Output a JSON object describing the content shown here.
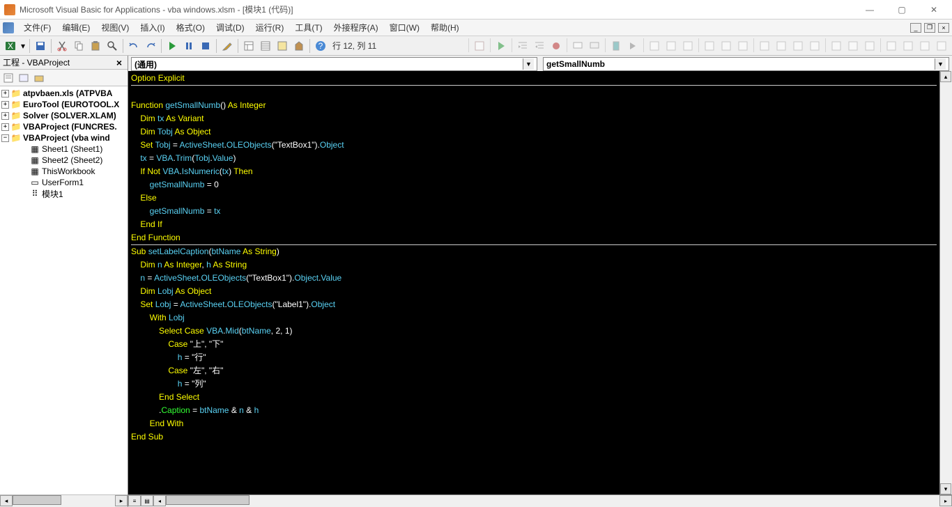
{
  "title": "Microsoft Visual Basic for Applications - vba windows.xlsm - [模块1 (代码)]",
  "menus": {
    "file": "文件(F)",
    "edit": "编辑(E)",
    "view": "视图(V)",
    "insert": "插入(I)",
    "format": "格式(O)",
    "debug": "调试(D)",
    "run": "运行(R)",
    "tools": "工具(T)",
    "addins": "外接程序(A)",
    "window": "窗口(W)",
    "help": "帮助(H)"
  },
  "cursor_position": "行 12, 列 11",
  "project_panel_title": "工程 - VBAProject",
  "tree": {
    "n0": "atpvbaen.xls (ATPVBA",
    "n1": "EuroTool (EUROTOOL.X",
    "n2": "Solver (SOLVER.XLAM)",
    "n3": "VBAProject (FUNCRES.",
    "n4": "VBAProject (vba wind",
    "c0": "Sheet1 (Sheet1)",
    "c1": "Sheet2 (Sheet2)",
    "c2": "ThisWorkbook",
    "c3": "UserForm1",
    "c4": "模块1"
  },
  "combo_left": "(通用)",
  "combo_right": "getSmallNumb",
  "chart_data": {
    "type": "table",
    "note": "VBA source code lines with syntax-highlight token classes",
    "lines": [
      [
        [
          "kw",
          "Option Explicit"
        ]
      ],
      [],
      [
        [
          "kw",
          "Function"
        ],
        [
          "sp",
          " "
        ],
        [
          "id",
          "getSmallNumb"
        ],
        [
          "op",
          "()"
        ],
        [
          "sp",
          " "
        ],
        [
          "kw",
          "As Integer"
        ]
      ],
      [
        [
          "sp",
          "    "
        ],
        [
          "kw",
          "Dim"
        ],
        [
          "sp",
          " "
        ],
        [
          "id",
          "tx"
        ],
        [
          "sp",
          " "
        ],
        [
          "kw",
          "As Variant"
        ]
      ],
      [
        [
          "sp",
          "    "
        ],
        [
          "kw",
          "Dim"
        ],
        [
          "sp",
          " "
        ],
        [
          "id",
          "Tobj"
        ],
        [
          "sp",
          " "
        ],
        [
          "kw",
          "As Object"
        ]
      ],
      [
        [
          "sp",
          "    "
        ],
        [
          "kw",
          "Set"
        ],
        [
          "sp",
          " "
        ],
        [
          "id",
          "Tobj"
        ],
        [
          "sp",
          " "
        ],
        [
          "op",
          "="
        ],
        [
          "sp",
          " "
        ],
        [
          "id",
          "ActiveSheet"
        ],
        [
          "op",
          "."
        ],
        [
          "id",
          "OLEObjects"
        ],
        [
          "op",
          "("
        ],
        [
          "str",
          "\"TextBox1\""
        ],
        [
          "op",
          ")."
        ],
        [
          "id",
          "Object"
        ]
      ],
      [
        [
          "sp",
          "    "
        ],
        [
          "id",
          "tx"
        ],
        [
          "sp",
          " "
        ],
        [
          "op",
          "="
        ],
        [
          "sp",
          " "
        ],
        [
          "id",
          "VBA"
        ],
        [
          "op",
          "."
        ],
        [
          "id",
          "Trim"
        ],
        [
          "op",
          "("
        ],
        [
          "id",
          "Tobj"
        ],
        [
          "op",
          "."
        ],
        [
          "id",
          "Value"
        ],
        [
          "op",
          ")"
        ]
      ],
      [
        [
          "sp",
          "    "
        ],
        [
          "kw",
          "If Not"
        ],
        [
          "sp",
          " "
        ],
        [
          "id",
          "VBA"
        ],
        [
          "op",
          "."
        ],
        [
          "id",
          "IsNumeric"
        ],
        [
          "op",
          "("
        ],
        [
          "id",
          "tx"
        ],
        [
          "op",
          ")"
        ],
        [
          "sp",
          " "
        ],
        [
          "kw",
          "Then"
        ]
      ],
      [
        [
          "sp",
          "        "
        ],
        [
          "id",
          "getSmallNumb"
        ],
        [
          "sp",
          " "
        ],
        [
          "op",
          "="
        ],
        [
          "sp",
          " "
        ],
        [
          "num",
          "0"
        ]
      ],
      [
        [
          "sp",
          "    "
        ],
        [
          "kw",
          "Else"
        ]
      ],
      [
        [
          "sp",
          "        "
        ],
        [
          "id",
          "getSmallNumb"
        ],
        [
          "sp",
          " "
        ],
        [
          "op",
          "="
        ],
        [
          "sp",
          " "
        ],
        [
          "id",
          "tx"
        ]
      ],
      [
        [
          "sp",
          "    "
        ],
        [
          "kw",
          "End If"
        ]
      ],
      [
        [
          "kw",
          "End Function"
        ]
      ],
      "HR",
      [
        [
          "kw",
          "Sub"
        ],
        [
          "sp",
          " "
        ],
        [
          "id",
          "setLabelCaption"
        ],
        [
          "op",
          "("
        ],
        [
          "id",
          "btName"
        ],
        [
          "sp",
          " "
        ],
        [
          "kw",
          "As String"
        ],
        [
          "op",
          ")"
        ]
      ],
      [
        [
          "sp",
          "    "
        ],
        [
          "kw",
          "Dim"
        ],
        [
          "sp",
          " "
        ],
        [
          "id",
          "n"
        ],
        [
          "sp",
          " "
        ],
        [
          "kw",
          "As Integer"
        ],
        [
          "op",
          ","
        ],
        [
          "sp",
          " "
        ],
        [
          "id",
          "h"
        ],
        [
          "sp",
          " "
        ],
        [
          "kw",
          "As String"
        ]
      ],
      [
        [
          "sp",
          "    "
        ],
        [
          "id",
          "n"
        ],
        [
          "sp",
          " "
        ],
        [
          "op",
          "="
        ],
        [
          "sp",
          " "
        ],
        [
          "id",
          "ActiveSheet"
        ],
        [
          "op",
          "."
        ],
        [
          "id",
          "OLEObjects"
        ],
        [
          "op",
          "("
        ],
        [
          "str",
          "\"TextBox1\""
        ],
        [
          "op",
          ")."
        ],
        [
          "id",
          "Object"
        ],
        [
          "op",
          "."
        ],
        [
          "id",
          "Value"
        ]
      ],
      [
        [
          "sp",
          "    "
        ],
        [
          "kw",
          "Dim"
        ],
        [
          "sp",
          " "
        ],
        [
          "id",
          "Lobj"
        ],
        [
          "sp",
          " "
        ],
        [
          "kw",
          "As Object"
        ]
      ],
      [
        [
          "sp",
          "    "
        ],
        [
          "kw",
          "Set"
        ],
        [
          "sp",
          " "
        ],
        [
          "id",
          "Lobj"
        ],
        [
          "sp",
          " "
        ],
        [
          "op",
          "="
        ],
        [
          "sp",
          " "
        ],
        [
          "id",
          "ActiveSheet"
        ],
        [
          "op",
          "."
        ],
        [
          "id",
          "OLEObjects"
        ],
        [
          "op",
          "("
        ],
        [
          "str",
          "\"Label1\""
        ],
        [
          "op",
          ")."
        ],
        [
          "id",
          "Object"
        ]
      ],
      [
        [
          "sp",
          "        "
        ],
        [
          "kw",
          "With"
        ],
        [
          "sp",
          " "
        ],
        [
          "id",
          "Lobj"
        ]
      ],
      [
        [
          "sp",
          "            "
        ],
        [
          "kw",
          "Select Case"
        ],
        [
          "sp",
          " "
        ],
        [
          "id",
          "VBA"
        ],
        [
          "op",
          "."
        ],
        [
          "id",
          "Mid"
        ],
        [
          "op",
          "("
        ],
        [
          "id",
          "btName"
        ],
        [
          "op",
          ","
        ],
        [
          "sp",
          " "
        ],
        [
          "num",
          "2"
        ],
        [
          "op",
          ","
        ],
        [
          "sp",
          " "
        ],
        [
          "num",
          "1"
        ],
        [
          "op",
          ")"
        ]
      ],
      [
        [
          "sp",
          "                "
        ],
        [
          "kw",
          "Case"
        ],
        [
          "sp",
          " "
        ],
        [
          "str",
          "\"上\""
        ],
        [
          "op",
          ","
        ],
        [
          "sp",
          " "
        ],
        [
          "str",
          "\"下\""
        ]
      ],
      [
        [
          "sp",
          "                    "
        ],
        [
          "id",
          "h"
        ],
        [
          "sp",
          " "
        ],
        [
          "op",
          "="
        ],
        [
          "sp",
          " "
        ],
        [
          "str",
          "\"行\""
        ]
      ],
      [
        [
          "sp",
          "                "
        ],
        [
          "kw",
          "Case"
        ],
        [
          "sp",
          " "
        ],
        [
          "str",
          "\"左\""
        ],
        [
          "op",
          ","
        ],
        [
          "sp",
          " "
        ],
        [
          "str",
          "\"右\""
        ]
      ],
      [
        [
          "sp",
          "                    "
        ],
        [
          "id",
          "h"
        ],
        [
          "sp",
          " "
        ],
        [
          "op",
          "="
        ],
        [
          "sp",
          " "
        ],
        [
          "str",
          "\"列\""
        ]
      ],
      [
        [
          "sp",
          "            "
        ],
        [
          "kw",
          "End Select"
        ]
      ],
      [
        [
          "sp",
          "            "
        ],
        [
          "op",
          "."
        ],
        [
          "mem",
          "Caption"
        ],
        [
          "sp",
          " "
        ],
        [
          "op",
          "="
        ],
        [
          "sp",
          " "
        ],
        [
          "id",
          "btName"
        ],
        [
          "sp",
          " "
        ],
        [
          "op",
          "&"
        ],
        [
          "sp",
          " "
        ],
        [
          "id",
          "n"
        ],
        [
          "sp",
          " "
        ],
        [
          "op",
          "&"
        ],
        [
          "sp",
          " "
        ],
        [
          "id",
          "h"
        ]
      ],
      [
        [
          "sp",
          "        "
        ],
        [
          "kw",
          "End With"
        ]
      ],
      [
        [
          "kw",
          "End Sub"
        ]
      ]
    ]
  }
}
